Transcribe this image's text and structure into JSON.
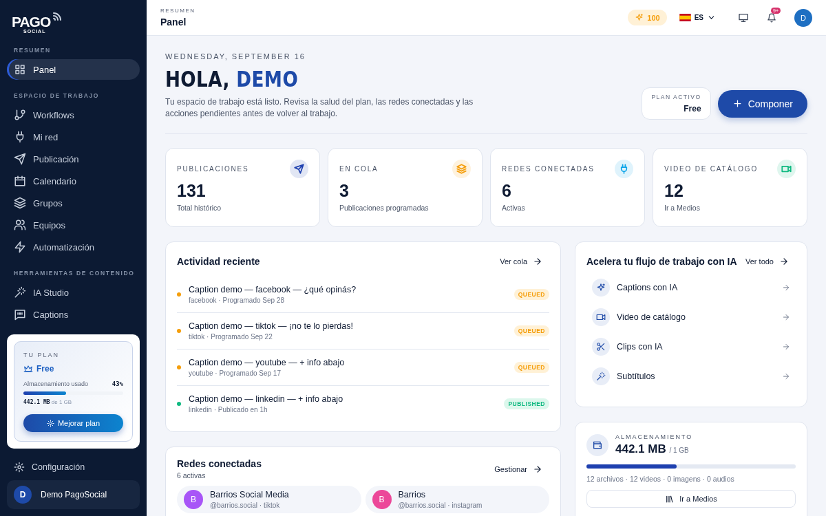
{
  "sidebar": {
    "logo": "PAGO",
    "logo_sub": "SOCIAL",
    "sections": [
      {
        "title": "RESUMEN",
        "items": [
          {
            "label": "Panel",
            "kind": "grid",
            "selected": true
          }
        ]
      },
      {
        "title": "ESPACIO DE TRABAJO",
        "items": [
          {
            "label": "Workflows",
            "kind": "branch",
            "selected": false
          },
          {
            "label": "Mi red",
            "kind": "plug",
            "selected": false
          },
          {
            "label": "Publicación",
            "kind": "send",
            "selected": false
          },
          {
            "label": "Calendario",
            "kind": "calendar",
            "selected": false
          },
          {
            "label": "Grupos",
            "kind": "layers",
            "selected": false
          },
          {
            "label": "Equipos",
            "kind": "users",
            "selected": false
          },
          {
            "label": "Automatización",
            "kind": "bolt",
            "selected": false
          }
        ]
      },
      {
        "title": "HERRAMIENTAS DE CONTENIDO",
        "items": [
          {
            "label": "IA Studio",
            "kind": "wand",
            "selected": false
          },
          {
            "label": "Captions",
            "kind": "quote",
            "selected": false
          }
        ]
      }
    ],
    "plan": {
      "title": "TU PLAN",
      "name": "Free",
      "storage_label": "Almacenamiento usado",
      "percent": "43%",
      "level": 0.43,
      "used": "442.1 MB",
      "of": "de 1 GB",
      "button": "Mejorar plan"
    },
    "settings": "Configuración",
    "user": {
      "initial": "D",
      "name": "Demo PagoSocial"
    }
  },
  "topbar": {
    "breadcrumb": "RESUMEN",
    "title": "Panel",
    "credits": "100",
    "language": "ES",
    "notifications": "9+",
    "avatar": "D"
  },
  "hero": {
    "date": "WEDNESDAY, SEPTEMBER 16",
    "greeting": "HOLA,",
    "name": "DEMO",
    "description": "Tu espacio de trabajo está listo. Revisa la salud del plan, las redes conectadas y las acciones pendientes antes de volver al trabajo.",
    "plan_label": "PLAN ACTIVO",
    "plan_value": "Free",
    "compose": "Componer"
  },
  "stats": [
    {
      "label": "PUBLICACIONES",
      "value": "131",
      "sub": "Total histórico",
      "kind": "send",
      "color": "#1e40af"
    },
    {
      "label": "EN COLA",
      "value": "3",
      "sub": "Publicaciones programadas",
      "kind": "layers",
      "color": "#f59e0b"
    },
    {
      "label": "REDES CONECTADAS",
      "value": "6",
      "sub": "Activas",
      "kind": "plug",
      "color": "#0ea5e9"
    },
    {
      "label": "VIDEO DE CATÁLOGO",
      "value": "12",
      "sub": "Ir a Medios",
      "kind": "video",
      "color": "#10b981"
    }
  ],
  "activity": {
    "title": "Actividad reciente",
    "link": "Ver cola",
    "items": [
      {
        "title": "Caption demo — facebook — ¿qué opinás?",
        "meta": "facebook · Programado Sep 28",
        "status": "QUEUED",
        "kind": "queued"
      },
      {
        "title": "Caption demo — tiktok — ¡no te lo pierdas!",
        "meta": "tiktok · Programado Sep 22",
        "status": "QUEUED",
        "kind": "queued"
      },
      {
        "title": "Caption demo — youtube — + info abajo",
        "meta": "youtube · Programado Sep 17",
        "status": "QUEUED",
        "kind": "queued"
      },
      {
        "title": "Caption demo — linkedin — + info abajo",
        "meta": "linkedin · Publicado en 1h",
        "status": "PUBLISHED",
        "kind": "published"
      }
    ]
  },
  "networks": {
    "title": "Redes conectadas",
    "subtitle": "6 activas",
    "link": "Gestionar",
    "accounts": [
      {
        "initial": "B",
        "name": "Barrios Social Media",
        "handle": "@barrios.social · tiktok",
        "color": "#a855f7"
      },
      {
        "initial": "B",
        "name": "Barrios",
        "handle": "@barrios.social · instagram",
        "color": "#ec4899"
      }
    ]
  },
  "ai": {
    "title": "Acelera tu flujo de trabajo con IA",
    "link": "Ver todo",
    "items": [
      {
        "label": "Captions con IA",
        "kind": "sparkle"
      },
      {
        "label": "Video de catálogo",
        "kind": "video"
      },
      {
        "label": "Clips con IA",
        "kind": "scissors"
      },
      {
        "label": "Subtítulos",
        "kind": "wand"
      }
    ]
  },
  "storage": {
    "label": "ALMACENAMIENTO",
    "value": "442.1 MB",
    "total": "/ 1 GB",
    "level": 0.43,
    "summary": "12 archivos · 12 videos · 0 imagens · 0 audios",
    "button": "Ir a Medios"
  }
}
